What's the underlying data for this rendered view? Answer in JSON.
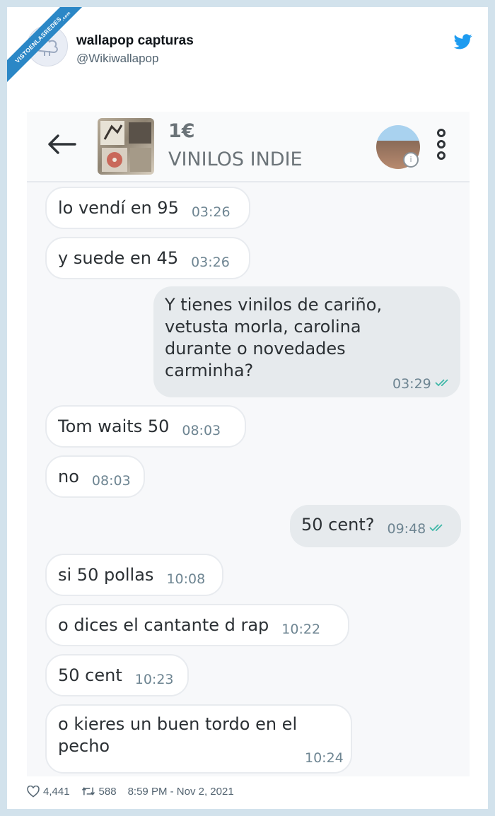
{
  "watermark": {
    "text": "VISTOENLASREDES",
    "suffix": ".com"
  },
  "tweet": {
    "author_name": "wallapop capturas",
    "author_handle": "@Wikiwallapop",
    "likes": "4,441",
    "retweets": "588",
    "timestamp": "8:59 PM - Nov 2, 2021"
  },
  "chat": {
    "price": "1€",
    "item_title": "VINILOS INDIE",
    "messages": [
      {
        "side": "in",
        "text": "lo vendí en 95",
        "time": "03:26"
      },
      {
        "side": "in",
        "text": "y suede en 45",
        "time": "03:26"
      },
      {
        "side": "out",
        "lines": [
          "Y tienes vinilos de cariño,",
          "vetusta morla, carolina",
          "durante o novedades",
          "carminha?"
        ],
        "time": "03:29"
      },
      {
        "side": "in",
        "text": "Tom waits 50",
        "time": "08:03"
      },
      {
        "side": "in",
        "text": "no",
        "time": "08:03"
      },
      {
        "side": "out",
        "text": "50 cent?",
        "time": "09:48"
      },
      {
        "side": "in",
        "text": "si 50 pollas",
        "time": "10:08"
      },
      {
        "side": "in",
        "text": "o dices el cantante d rap",
        "time": "10:22"
      },
      {
        "side": "in",
        "text": "50 cent",
        "time": "10:23"
      },
      {
        "side": "in",
        "lines": [
          "o kieres un buen tordo en el",
          "pecho"
        ],
        "time": "10:24"
      }
    ]
  },
  "colors": {
    "page_bg": "#d2e2ec",
    "twitter_blue": "#1d9bf0",
    "check_teal": "#3fb8a8",
    "outgoing_bubble": "#e6eaed"
  },
  "icons": [
    "back-arrow-icon",
    "more-vertical-icon",
    "info-icon",
    "twitter-bird-icon",
    "heart-icon",
    "retweet-icon",
    "double-check-icon"
  ]
}
